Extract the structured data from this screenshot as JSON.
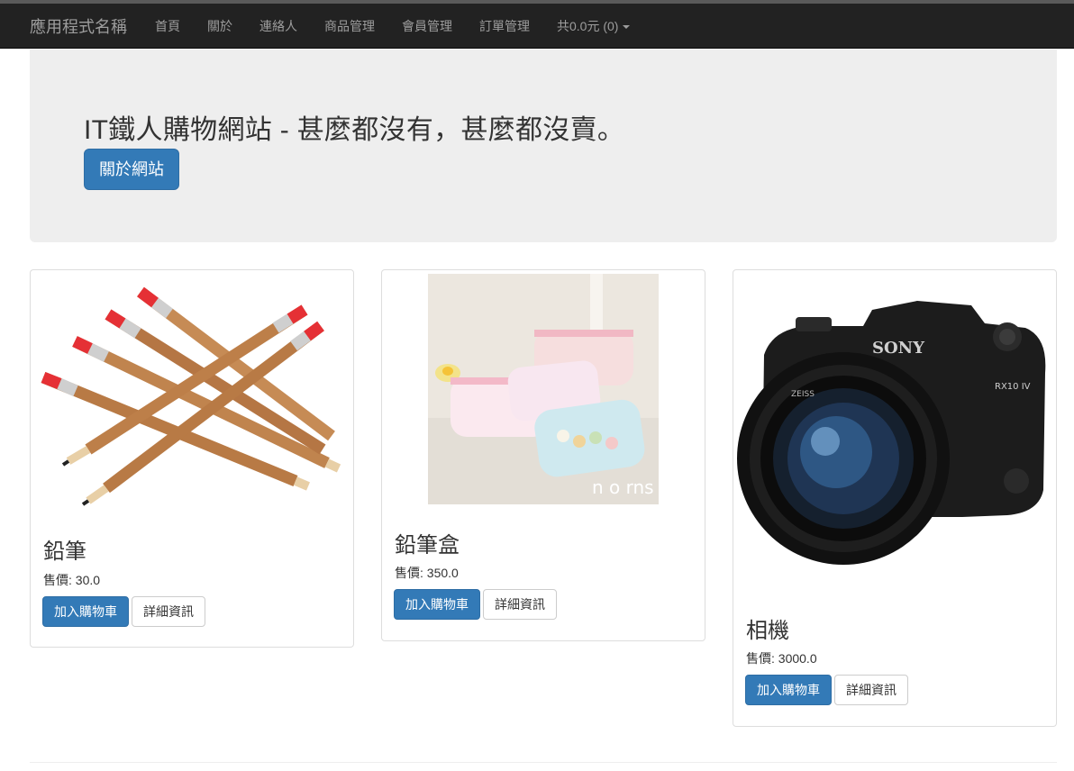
{
  "navbar": {
    "brand": "應用程式名稱",
    "items": [
      "首頁",
      "關於",
      "連絡人",
      "商品管理",
      "會員管理",
      "訂單管理"
    ],
    "cart_label": "共0.0元 (0)"
  },
  "jumbotron": {
    "title": "IT鐵人購物網站 - 甚麼都沒有，甚麼都沒賣。",
    "button_label": "關於網站"
  },
  "products": [
    {
      "name": "鉛筆",
      "price": "售價: 30.0",
      "add_label": "加入購物車",
      "detail_label": "詳細資訊",
      "image": "pencils-photo"
    },
    {
      "name": "鉛筆盒",
      "price": "售價: 350.0",
      "add_label": "加入購物車",
      "detail_label": "詳細資訊",
      "image": "pencil-case-photo"
    },
    {
      "name": "相機",
      "price": "售價: 3000.0",
      "add_label": "加入購物車",
      "detail_label": "詳細資訊",
      "image": "camera-photo"
    }
  ],
  "colors": {
    "navbar": "#222222",
    "nav_text": "#9d9d9d",
    "primary": "#337ab7",
    "jumbotron": "#eeeeee"
  }
}
